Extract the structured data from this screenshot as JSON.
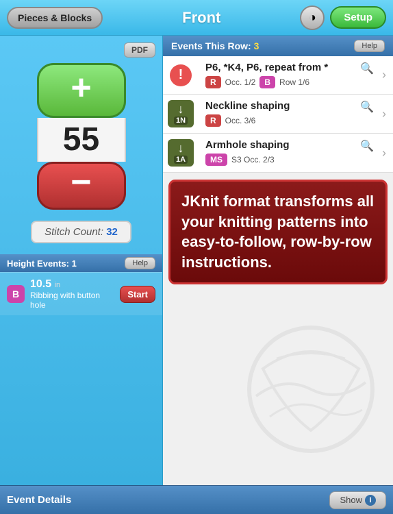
{
  "header": {
    "pieces_btn": "Pieces & Blocks",
    "title": "Front",
    "setup_btn": "Setup"
  },
  "left": {
    "pdf_btn": "PDF",
    "counter_value": "55",
    "stitch_count_label": "Stitch Count:",
    "stitch_count_value": "32",
    "height_events_label": "Height Events:",
    "height_events_count": "1",
    "help_btn": "Help",
    "event": {
      "badge": "B",
      "number": "10.5",
      "unit": "in",
      "desc": "Ribbing with button hole",
      "start_btn": "Start"
    }
  },
  "right": {
    "events_header": "Events This Row:",
    "events_count": "3",
    "help_btn": "Help",
    "search_icon": "🔍",
    "events": [
      {
        "icon_type": "exclamation",
        "title": "P6, *K4, P6, repeat from *",
        "tags": [
          {
            "type": "R",
            "label": "R",
            "detail": "Occ. 1/2"
          },
          {
            "type": "B",
            "label": "B",
            "detail": "Row 1/6"
          }
        ]
      },
      {
        "icon_type": "arrow",
        "icon_label": "1N",
        "title": "Neckline shaping",
        "tags": [
          {
            "type": "R",
            "label": "R",
            "detail": "Occ. 3/6"
          }
        ]
      },
      {
        "icon_type": "arrow",
        "icon_label": "1A",
        "title": "Armhole shaping",
        "tags": [
          {
            "type": "MS",
            "label": "MS",
            "detail": "S3 Occ. 2/3"
          }
        ]
      }
    ],
    "promo_text": "JKnit format transforms all your knitting patterns into easy-to-follow, row-by-row instructions."
  },
  "bottom": {
    "title": "Event Details",
    "show_btn": "Show",
    "info_icon": "i"
  },
  "colors": {
    "accent_blue": "#3570a8",
    "header_blue": "#3ab8e8",
    "green_btn": "#5ab83a",
    "red_btn": "#b03030",
    "promo_bg": "#8b1a1a"
  }
}
